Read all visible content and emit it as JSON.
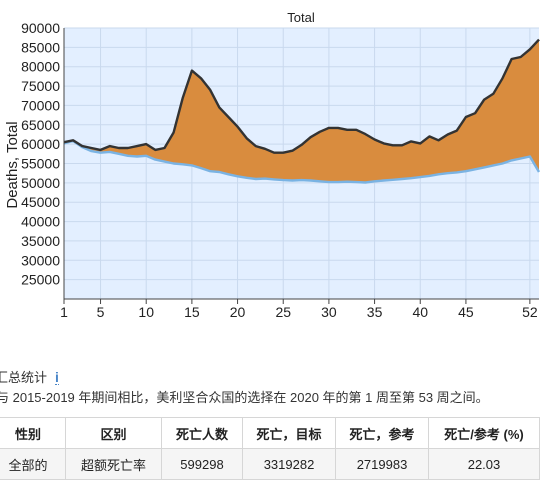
{
  "chart_data": {
    "type": "area",
    "title": "Total",
    "ylabel": "Deaths, Total",
    "xlabel": "",
    "xlim": [
      1,
      53
    ],
    "ylim": [
      20000,
      90000
    ],
    "x_ticks": [
      1,
      5,
      10,
      15,
      20,
      25,
      30,
      35,
      40,
      45,
      52
    ],
    "y_ticks": [
      25000,
      30000,
      35000,
      40000,
      45000,
      50000,
      55000,
      60000,
      65000,
      70000,
      75000,
      80000,
      85000,
      90000
    ],
    "grid": true,
    "x": [
      1,
      2,
      3,
      4,
      5,
      6,
      7,
      8,
      9,
      10,
      11,
      12,
      13,
      14,
      15,
      16,
      17,
      18,
      19,
      20,
      21,
      22,
      23,
      24,
      25,
      26,
      27,
      28,
      29,
      30,
      31,
      32,
      33,
      34,
      35,
      36,
      37,
      38,
      39,
      40,
      41,
      42,
      43,
      44,
      45,
      46,
      47,
      48,
      49,
      50,
      51,
      52,
      53
    ],
    "series": [
      {
        "role": "target",
        "color": "#333333",
        "values": [
          60500,
          61000,
          59500,
          59000,
          58500,
          59500,
          59000,
          59000,
          59500,
          60000,
          58500,
          59000,
          63000,
          72000,
          79000,
          77000,
          74000,
          69500,
          67000,
          64500,
          61500,
          59500,
          58800,
          57800,
          57800,
          58300,
          59800,
          61800,
          63200,
          64200,
          64200,
          63700,
          63700,
          62600,
          61200,
          60200,
          59700,
          59700,
          60700,
          60200,
          62000,
          61000,
          62500,
          63500,
          67000,
          68000,
          71500,
          73000,
          77000,
          82000,
          82500,
          84500,
          87000
        ]
      },
      {
        "role": "reference",
        "color": "#7ab3e3",
        "values": [
          60200,
          60800,
          59200,
          58200,
          57800,
          58000,
          57500,
          57000,
          56800,
          57000,
          56000,
          55500,
          55000,
          54800,
          54500,
          53800,
          53000,
          52800,
          52200,
          51700,
          51300,
          51000,
          51100,
          50900,
          50700,
          50600,
          50700,
          50600,
          50400,
          50200,
          50200,
          50300,
          50200,
          50100,
          50400,
          50600,
          50800,
          51000,
          51200,
          51500,
          51800,
          52200,
          52500,
          52700,
          53000,
          53500,
          54000,
          54500,
          55000,
          55800,
          56300,
          56800,
          52800
        ]
      }
    ],
    "fill_between_color": "#d98c3e",
    "plot_background": "#e3efff"
  },
  "summary": {
    "title": "汇总统计",
    "info_icon": "info-icon",
    "description": "与 2015-2019 年期间相比，美利坚合众国的选择在 2020 年的第 1 周至第 53 周之间。",
    "table": {
      "headers": [
        "性别",
        "区别",
        "死亡人数",
        "死亡，目标",
        "死亡，参考",
        "死亡/参考 (%)"
      ],
      "rows": [
        [
          "全部的",
          "超额死亡率",
          "599298",
          "3319282",
          "2719983",
          "22.03"
        ]
      ]
    }
  }
}
